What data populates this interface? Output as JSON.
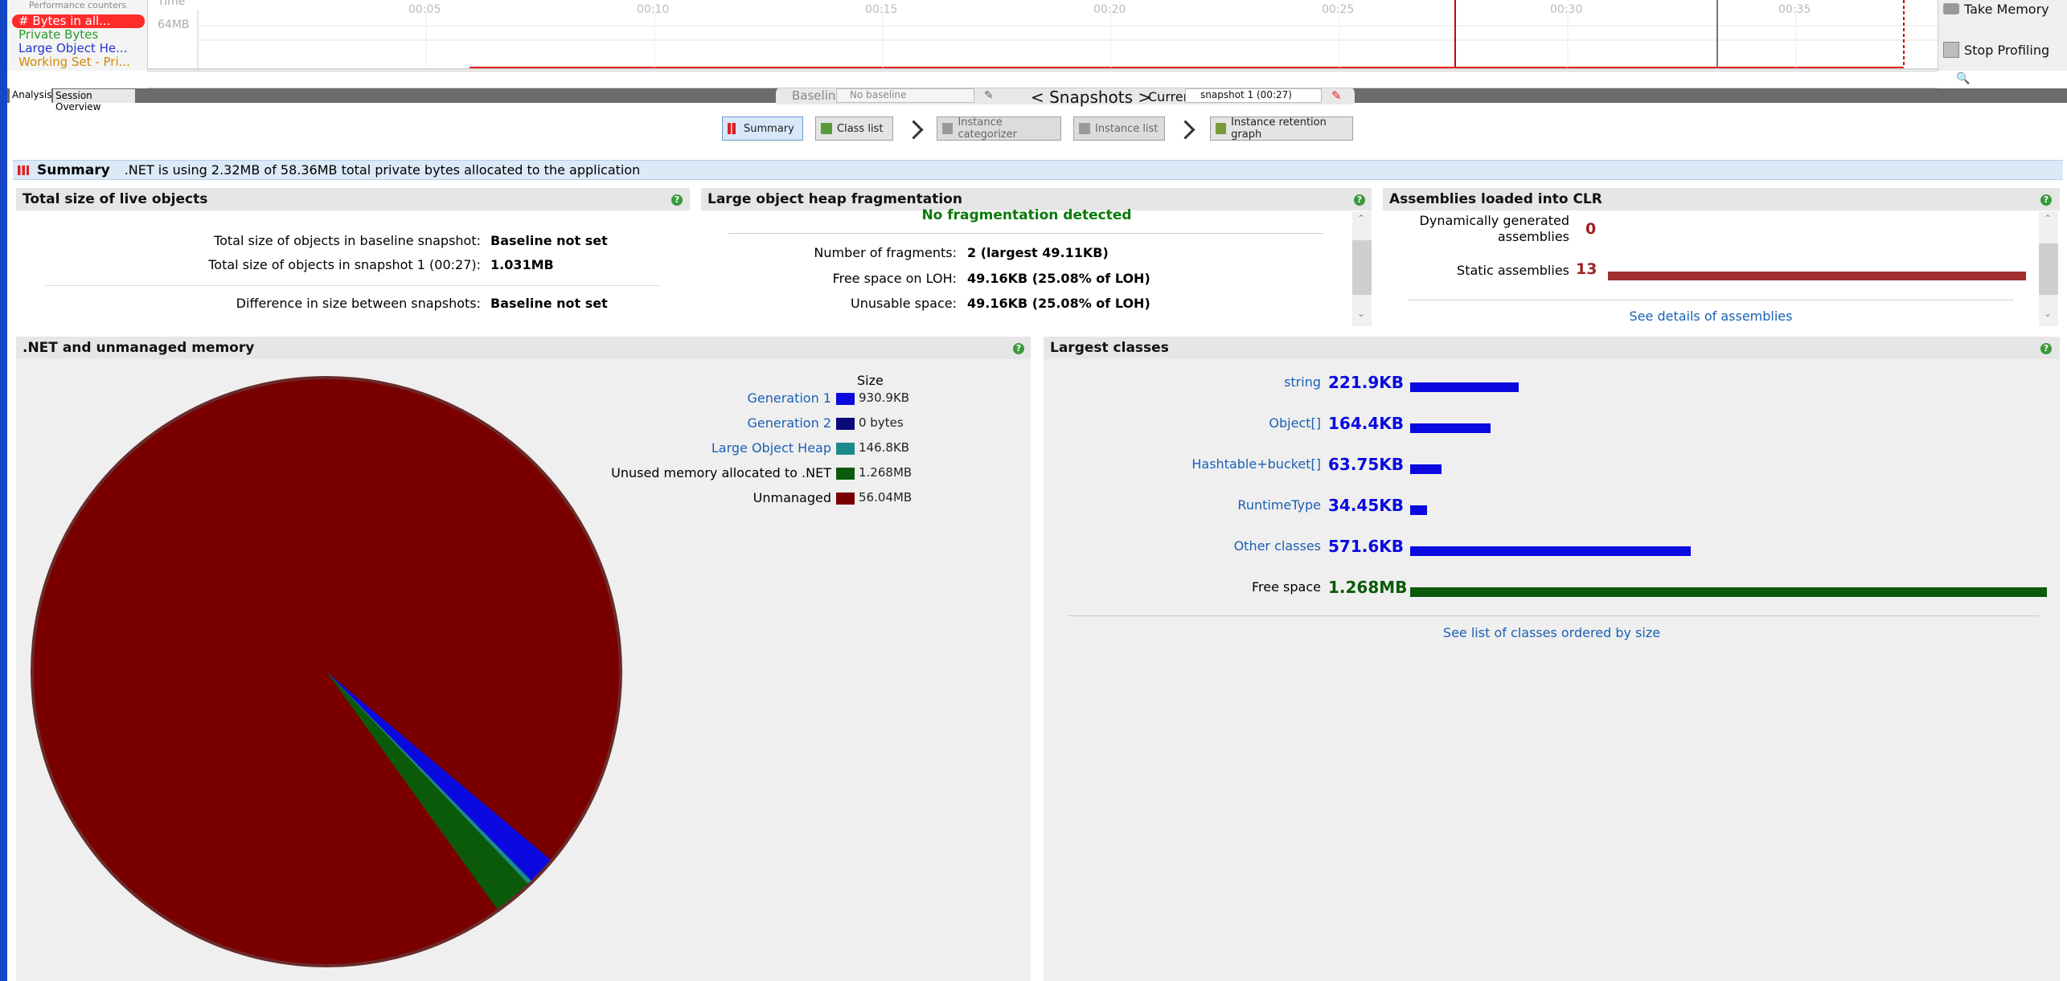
{
  "left_edge_color": "#1646c8",
  "counters": {
    "header": "Performance counters",
    "items": [
      {
        "label": "# Bytes in all...",
        "color": "#ffffff",
        "bg": "#ff2a2a"
      },
      {
        "label": "Private Bytes",
        "color": "#2a9a2a"
      },
      {
        "label": "Large Object He...",
        "color": "#2233cc"
      },
      {
        "label": "Working Set - Pri...",
        "color": "#d08a00"
      }
    ]
  },
  "timeline": {
    "axis_label": "Time",
    "y_label": "64MB",
    "ticks": [
      "00:05",
      "00:10",
      "00:15",
      "00:20",
      "00:25",
      "00:30",
      "00:35"
    ]
  },
  "actions": {
    "take_memory": "Take Memory",
    "stop_profiling": "Stop Profiling"
  },
  "tabs": {
    "analysis": "Analysis",
    "session_overview": "Session Overview"
  },
  "snapshot_bar": {
    "baseline_label": "Baselin",
    "baseline_value": "No baseline",
    "snapshots_label": "< Snapshots >",
    "current_label": "Currer",
    "current_value": "snapshot 1 (00:27)"
  },
  "nav": {
    "summary": "Summary",
    "class_list": "Class list",
    "instance_categorizer": "Instance categorizer",
    "instance_list": "Instance list",
    "instance_retention_graph": "Instance retention graph"
  },
  "summary_bar": {
    "title": "Summary",
    "text": ".NET is using 2.32MB of 58.36MB total private bytes allocated to the application"
  },
  "live_objects": {
    "title": "Total size of live objects",
    "rows": [
      {
        "label": "Total size of objects in baseline snapshot:",
        "value": "Baseline not set"
      },
      {
        "label": "Total size of objects in snapshot 1 (00:27):",
        "value": "1.031MB"
      },
      {
        "label": "Difference in size between snapshots:",
        "value": "Baseline not set"
      }
    ]
  },
  "loh": {
    "title": "Large object heap fragmentation",
    "status": "No fragmentation detected",
    "rows": [
      {
        "label": "Number of fragments:",
        "value": "2 (largest 49.11KB)"
      },
      {
        "label": "Free space on LOH:",
        "value": "49.16KB (25.08% of LOH)"
      },
      {
        "label": "Unusable space:",
        "value": "49.16KB (25.08% of LOH)"
      }
    ]
  },
  "assemblies": {
    "title": "Assemblies loaded into CLR",
    "dynamic_label": "Dynamically generated assemblies",
    "dynamic_value": "0",
    "static_label": "Static assemblies",
    "static_value": "13",
    "link": "See details of assemblies"
  },
  "memory": {
    "title": ".NET and unmanaged memory",
    "legend_header": "Size",
    "items": [
      {
        "label": "Generation 1",
        "value": "930.9KB",
        "color": "#0a0ae0",
        "link": true
      },
      {
        "label": "Generation 2",
        "value": "0 bytes",
        "color": "#0a0a7a",
        "link": true
      },
      {
        "label": "Large Object Heap",
        "value": "146.8KB",
        "color": "#1b8a8a",
        "link": true
      },
      {
        "label": "Unused memory allocated to .NET",
        "value": "1.268MB",
        "color": "#0a5a0a",
        "link": false
      },
      {
        "label": "Unmanaged",
        "value": "56.04MB",
        "color": "#7a0000",
        "link": false
      }
    ]
  },
  "largest": {
    "title": "Largest classes",
    "items": [
      {
        "label": "string",
        "value": "221.9KB",
        "kb": 221.9,
        "color": "#0a0ae0",
        "link": true
      },
      {
        "label": "Object[]",
        "value": "164.4KB",
        "kb": 164.4,
        "color": "#0a0ae0",
        "link": true
      },
      {
        "label": "Hashtable+bucket[]",
        "value": "63.75KB",
        "kb": 63.75,
        "color": "#0a0ae0",
        "link": true
      },
      {
        "label": "RuntimeType",
        "value": "34.45KB",
        "kb": 34.45,
        "color": "#0a0ae0",
        "link": true
      },
      {
        "label": "Other classes",
        "value": "571.6KB",
        "kb": 571.6,
        "color": "#0a0ae0",
        "link": true
      },
      {
        "label": "Free space",
        "value": "1.268MB",
        "kb": 1298.4,
        "color": "#0a5a0a",
        "link": false
      }
    ],
    "link": "See list of classes ordered by size"
  }
}
